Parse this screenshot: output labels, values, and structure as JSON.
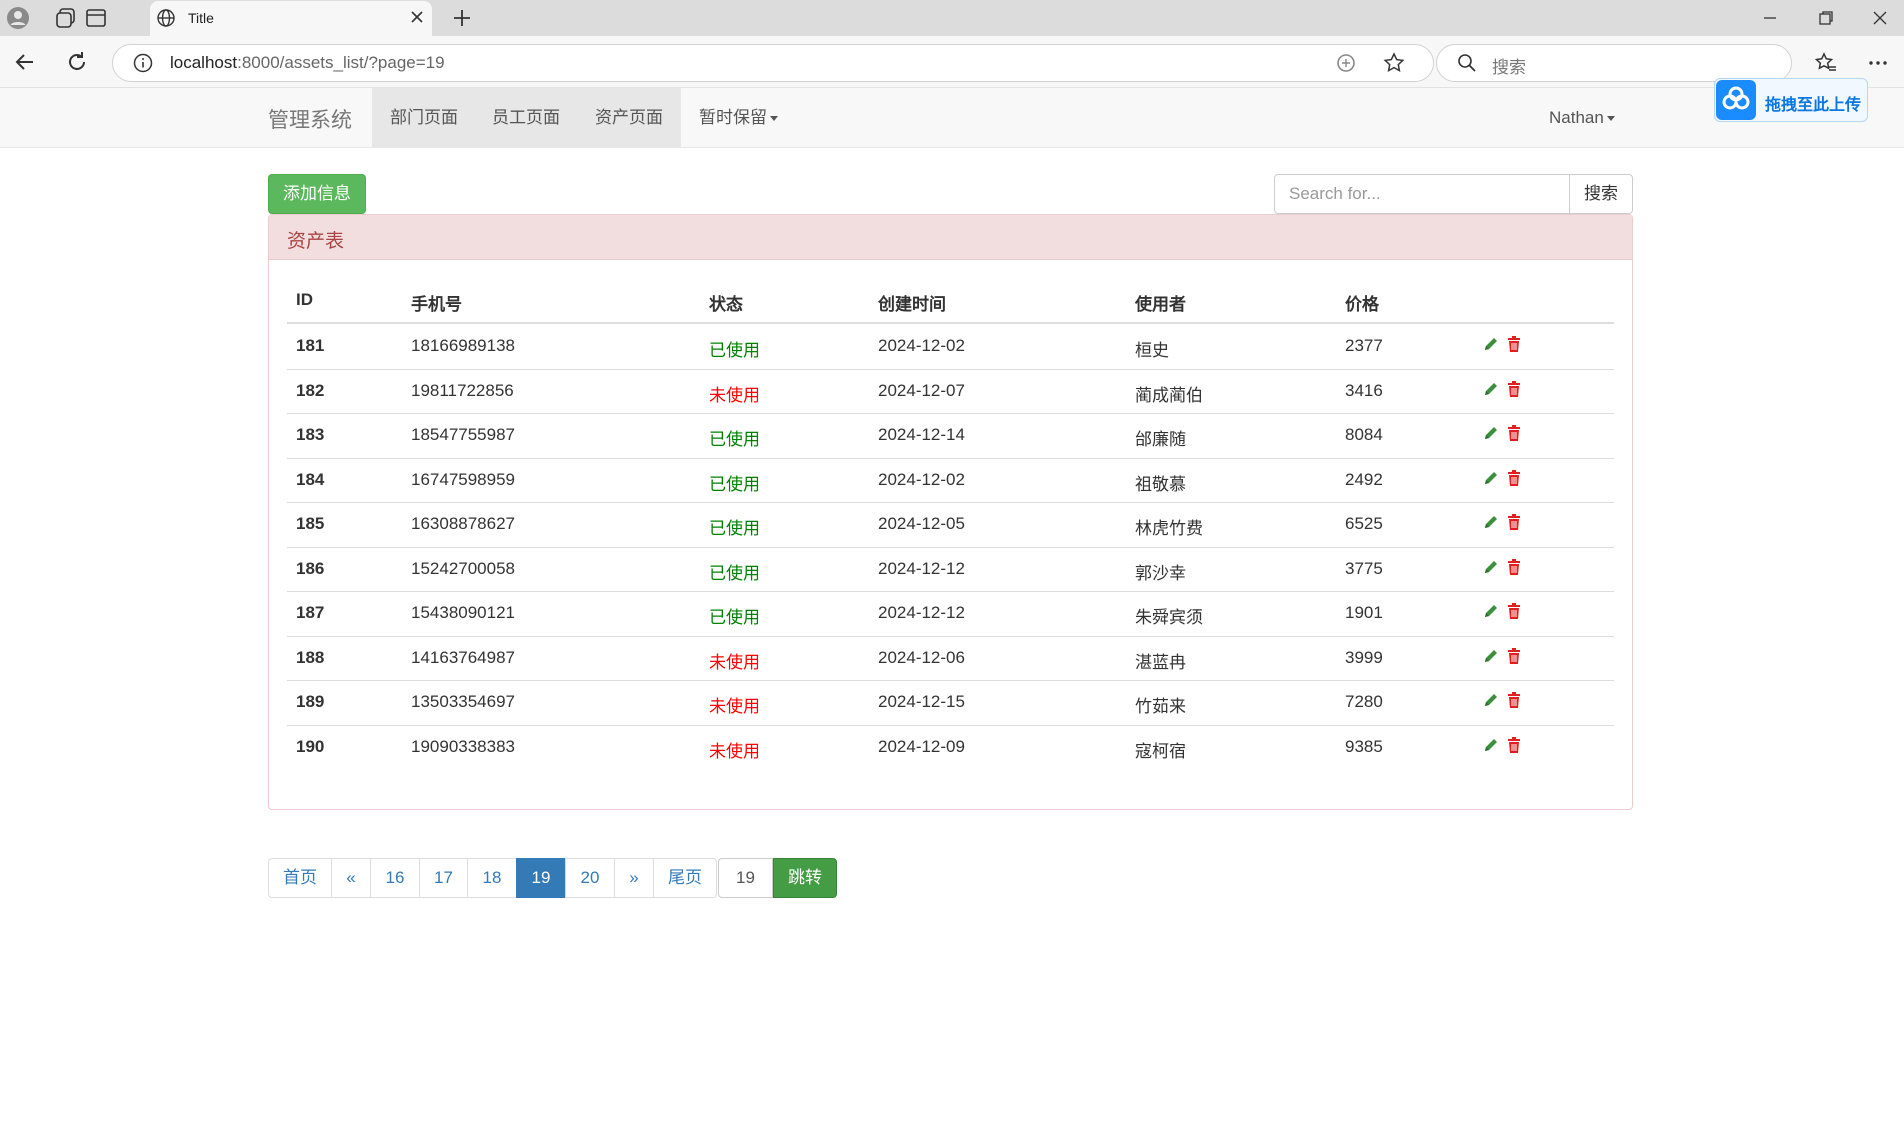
{
  "browser": {
    "tab_title": "Title",
    "url_host": "localhost",
    "url_rest": ":8000/assets_list/?page=19",
    "search_placeholder": "搜索"
  },
  "navbar": {
    "brand": "管理系统",
    "links": [
      {
        "label": "部门页面",
        "active": true
      },
      {
        "label": "员工页面",
        "active": true
      },
      {
        "label": "资产页面",
        "active": true
      },
      {
        "label": "暂时保留",
        "active": false,
        "dropdown": true
      }
    ],
    "user": "Nathan",
    "upload_widget": "拖拽至此上传"
  },
  "toolbar": {
    "add_button": "添加信息",
    "search_placeholder": "Search for...",
    "search_button": "搜索"
  },
  "panel": {
    "title": "资产表"
  },
  "table": {
    "headers": [
      "ID",
      "手机号",
      "状态",
      "创建时间",
      "使用者",
      "价格"
    ],
    "rows": [
      {
        "id": "181",
        "phone": "18166989138",
        "status": "已使用",
        "created": "2024-12-02",
        "user": "桓史",
        "price": "2377"
      },
      {
        "id": "182",
        "phone": "19811722856",
        "status": "未使用",
        "created": "2024-12-07",
        "user": "蔺成蔺伯",
        "price": "3416"
      },
      {
        "id": "183",
        "phone": "18547755987",
        "status": "已使用",
        "created": "2024-12-14",
        "user": "邰廉随",
        "price": "8084"
      },
      {
        "id": "184",
        "phone": "16747598959",
        "status": "已使用",
        "created": "2024-12-02",
        "user": "祖敬慕",
        "price": "2492"
      },
      {
        "id": "185",
        "phone": "16308878627",
        "status": "已使用",
        "created": "2024-12-05",
        "user": "林虎竹费",
        "price": "6525"
      },
      {
        "id": "186",
        "phone": "15242700058",
        "status": "已使用",
        "created": "2024-12-12",
        "user": "郭沙幸",
        "price": "3775"
      },
      {
        "id": "187",
        "phone": "15438090121",
        "status": "已使用",
        "created": "2024-12-12",
        "user": "朱舜宾须",
        "price": "1901"
      },
      {
        "id": "188",
        "phone": "14163764987",
        "status": "未使用",
        "created": "2024-12-06",
        "user": "湛蓝冉",
        "price": "3999"
      },
      {
        "id": "189",
        "phone": "13503354697",
        "status": "未使用",
        "created": "2024-12-15",
        "user": "竹茹来",
        "price": "7280"
      },
      {
        "id": "190",
        "phone": "19090338383",
        "status": "未使用",
        "created": "2024-12-09",
        "user": "寇柯宿",
        "price": "9385"
      }
    ]
  },
  "pagination": {
    "items": [
      {
        "label": "首页",
        "active": false
      },
      {
        "label": "«",
        "active": false
      },
      {
        "label": "16",
        "active": false
      },
      {
        "label": "17",
        "active": false
      },
      {
        "label": "18",
        "active": false
      },
      {
        "label": "19",
        "active": true
      },
      {
        "label": "20",
        "active": false
      },
      {
        "label": "»",
        "active": false
      },
      {
        "label": "尾页",
        "active": false
      }
    ],
    "jump_value": "19",
    "jump_button": "跳转"
  },
  "colors": {
    "status_used": "#008000",
    "status_unused": "#ff0000",
    "success": "#5cb85c",
    "primary": "#337ab7",
    "danger_panel": "#f2dede"
  }
}
